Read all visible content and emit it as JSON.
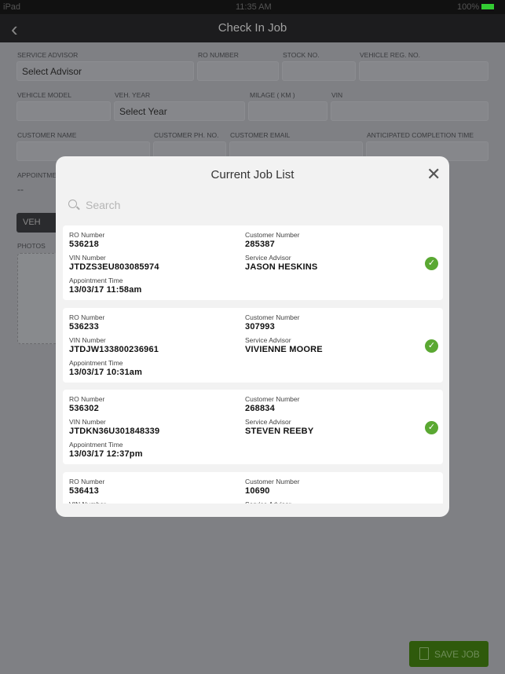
{
  "status_bar": {
    "device": "iPad",
    "time": "11:35 AM",
    "battery": "100%"
  },
  "nav": {
    "title": "Check In Job"
  },
  "form": {
    "service_advisor_label": "SERVICE ADVISOR",
    "service_advisor_value": "Select Advisor",
    "ro_number_label": "RO NUMBER",
    "stock_no_label": "STOCK NO.",
    "vehicle_reg_label": "VEHICLE REG. NO.",
    "vehicle_model_label": "VEHICLE MODEL",
    "veh_year_label": "VEH. YEAR",
    "veh_year_value": "Select Year",
    "milage_label": "MILAGE ( km )",
    "vin_label": "VIN",
    "customer_name_label": "CUSTOMER NAME",
    "customer_phone_label": "CUSTOMER PH. NO.",
    "customer_email_label": "CUSTOMER EMAIL",
    "completion_time_label": "ANTICIPATED COMPLETION TIME",
    "appointment_label": "APPOINTME",
    "appointment_value": "--",
    "vehicle_button": "VEH",
    "photos_label": "PHOTOS"
  },
  "save_button": "SAVE JOB",
  "modal": {
    "title": "Current Job List",
    "search_placeholder": "Search",
    "labels": {
      "ro": "RO Number",
      "customer": "Customer Number",
      "vin": "VIN Number",
      "advisor": "Service Advisor",
      "appointment": "Appointment Time"
    },
    "jobs": [
      {
        "ro": "536218",
        "customer": "285387",
        "vin": "JTDZS3EU803085974",
        "advisor": "JASON HESKINS",
        "appointment": "13/03/17 11:58am"
      },
      {
        "ro": "536233",
        "customer": "307993",
        "vin": "JTDJW133800236961",
        "advisor": "VIVIENNE MOORE",
        "appointment": "13/03/17 10:31am"
      },
      {
        "ro": "536302",
        "customer": "268834",
        "vin": "JTDKN36U301848339",
        "advisor": "STEVEN REEBY",
        "appointment": "13/03/17 12:37pm"
      },
      {
        "ro": "536413",
        "customer": "10690"
      }
    ]
  },
  "colors": {
    "accent_green": "#5aa832",
    "save_green": "#2f5a0c"
  }
}
